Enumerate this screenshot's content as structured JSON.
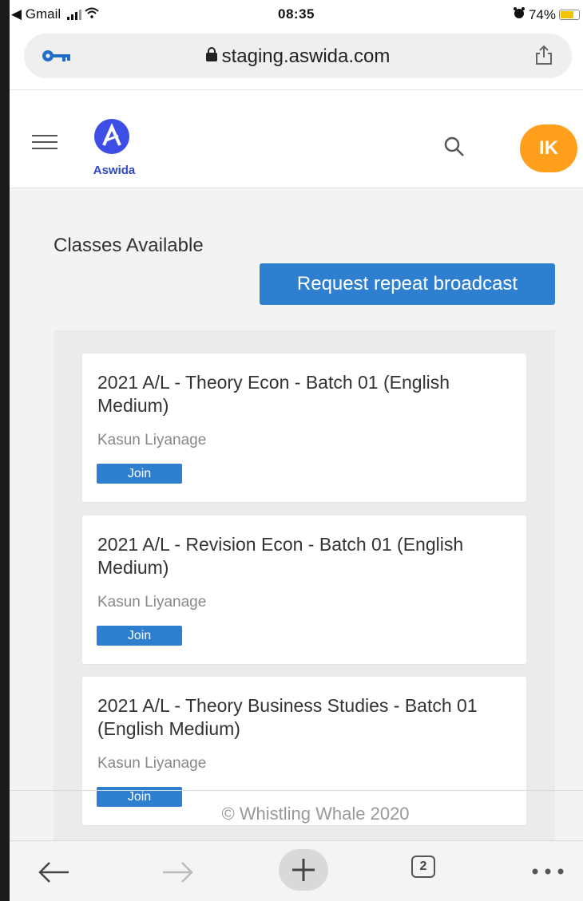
{
  "status_bar": {
    "back_app": "◀ Gmail",
    "time": "08:35",
    "battery_percent": "74%",
    "battery_level": 0.74
  },
  "browser": {
    "url": "staging.aswida.com",
    "tab_count": "2"
  },
  "header": {
    "logo_text": "Aswida",
    "avatar_initials": "IK",
    "avatar_color": "#ff9f1c",
    "brand_color": "#3d4ee6"
  },
  "main": {
    "title": "Classes Available",
    "repeat_button": "Request repeat broadcast",
    "accent_color": "#2f7fd1",
    "classes": [
      {
        "title": "2021 A/L - Theory Econ - Batch 01 (English Medium)",
        "teacher": "Kasun Liyanage",
        "join_label": "Join"
      },
      {
        "title": "2021 A/L - Revision Econ - Batch 01 (English Medium)",
        "teacher": "Kasun Liyanage",
        "join_label": "Join"
      },
      {
        "title": "2021 A/L - Theory Business Studies - Batch 01 (English Medium)",
        "teacher": "Kasun Liyanage",
        "join_label": "Join"
      }
    ]
  },
  "footer": {
    "text": "© Whistling Whale 2020"
  },
  "icons": [
    "key-icon",
    "lock-icon",
    "share-icon",
    "menu-icon",
    "search-icon",
    "back-arrow-icon",
    "forward-arrow-icon",
    "plus-icon",
    "more-icon"
  ]
}
